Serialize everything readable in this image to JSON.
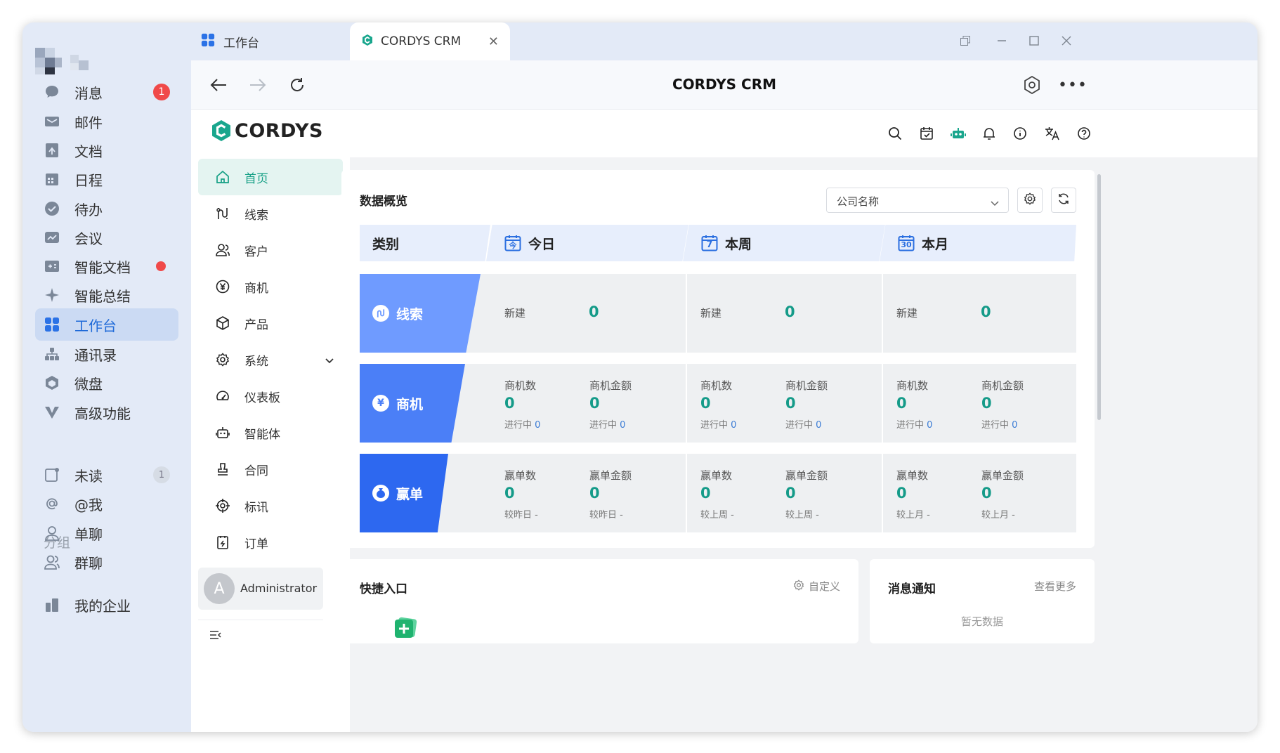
{
  "sidebar": {
    "items": [
      {
        "label": "消息",
        "badge": "1"
      },
      {
        "label": "邮件"
      },
      {
        "label": "文档"
      },
      {
        "label": "日程"
      },
      {
        "label": "待办"
      },
      {
        "label": "会议"
      },
      {
        "label": "智能文档",
        "dot": true
      },
      {
        "label": "智能总结"
      },
      {
        "label": "工作台",
        "active": true
      },
      {
        "label": "通讯录"
      },
      {
        "label": "微盘"
      },
      {
        "label": "高级功能"
      }
    ],
    "group_title": "分组",
    "groups": [
      {
        "label": "未读",
        "badge": "1"
      },
      {
        "label": "@我"
      },
      {
        "label": "单聊"
      },
      {
        "label": "群聊"
      }
    ],
    "bottom": "我的企业"
  },
  "tabs": [
    {
      "label": "工作台"
    },
    {
      "label": "CORDYS CRM"
    }
  ],
  "browser": {
    "title": "CORDYS CRM"
  },
  "app": {
    "logo": "CORDYS",
    "menu": [
      {
        "label": "首页"
      },
      {
        "label": "线索"
      },
      {
        "label": "客户"
      },
      {
        "label": "商机"
      },
      {
        "label": "产品"
      },
      {
        "label": "系统"
      },
      {
        "label": "仪表板"
      },
      {
        "label": "智能体"
      },
      {
        "label": "合同"
      },
      {
        "label": "标讯"
      },
      {
        "label": "订单"
      }
    ],
    "user": {
      "initial": "A",
      "name": "Administrator"
    }
  },
  "overview": {
    "title": "数据概览",
    "select_placeholder": "公司名称",
    "headers": {
      "category": "类别",
      "today": "今日",
      "week": "本周",
      "month": "本月"
    },
    "cal_icons": {
      "today": "今",
      "week": "7",
      "month": "30"
    },
    "rows": [
      {
        "label": "线索",
        "cols": [
          {
            "l1": "新建",
            "v1": "0"
          },
          {
            "l1": "新建",
            "v1": "0"
          },
          {
            "l1": "新建",
            "v1": "0"
          }
        ]
      },
      {
        "label": "商机",
        "cols": [
          {
            "l1": "商机数",
            "v1": "0",
            "s1": "进行中",
            "n1": "0",
            "l2": "商机金额",
            "v2": "0",
            "s2": "进行中",
            "n2": "0"
          },
          {
            "l1": "商机数",
            "v1": "0",
            "s1": "进行中",
            "n1": "0",
            "l2": "商机金额",
            "v2": "0",
            "s2": "进行中",
            "n2": "0"
          },
          {
            "l1": "商机数",
            "v1": "0",
            "s1": "进行中",
            "n1": "0",
            "l2": "商机金额",
            "v2": "0",
            "s2": "进行中",
            "n2": "0"
          }
        ]
      },
      {
        "label": "赢单",
        "cols": [
          {
            "l1": "赢单数",
            "v1": "0",
            "s1": "较昨日 -",
            "l2": "赢单金额",
            "v2": "0",
            "s2": "较昨日 -"
          },
          {
            "l1": "赢单数",
            "v1": "0",
            "s1": "较上周 -",
            "l2": "赢单金额",
            "v2": "0",
            "s2": "较上周 -"
          },
          {
            "l1": "赢单数",
            "v1": "0",
            "s1": "较上月 -",
            "l2": "赢单金额",
            "v2": "0",
            "s2": "较上月 -"
          }
        ]
      }
    ]
  },
  "quick": {
    "title": "快捷入口",
    "action": "自定义"
  },
  "notice": {
    "title": "消息通知",
    "action": "查看更多",
    "empty": "暂无数据"
  },
  "colors": {
    "accent": "#159b89",
    "sidebar_bg": "#e3eaf7",
    "row1": "#6f9bff",
    "row2": "#4b7ff7",
    "row3": "#2d68f0"
  }
}
